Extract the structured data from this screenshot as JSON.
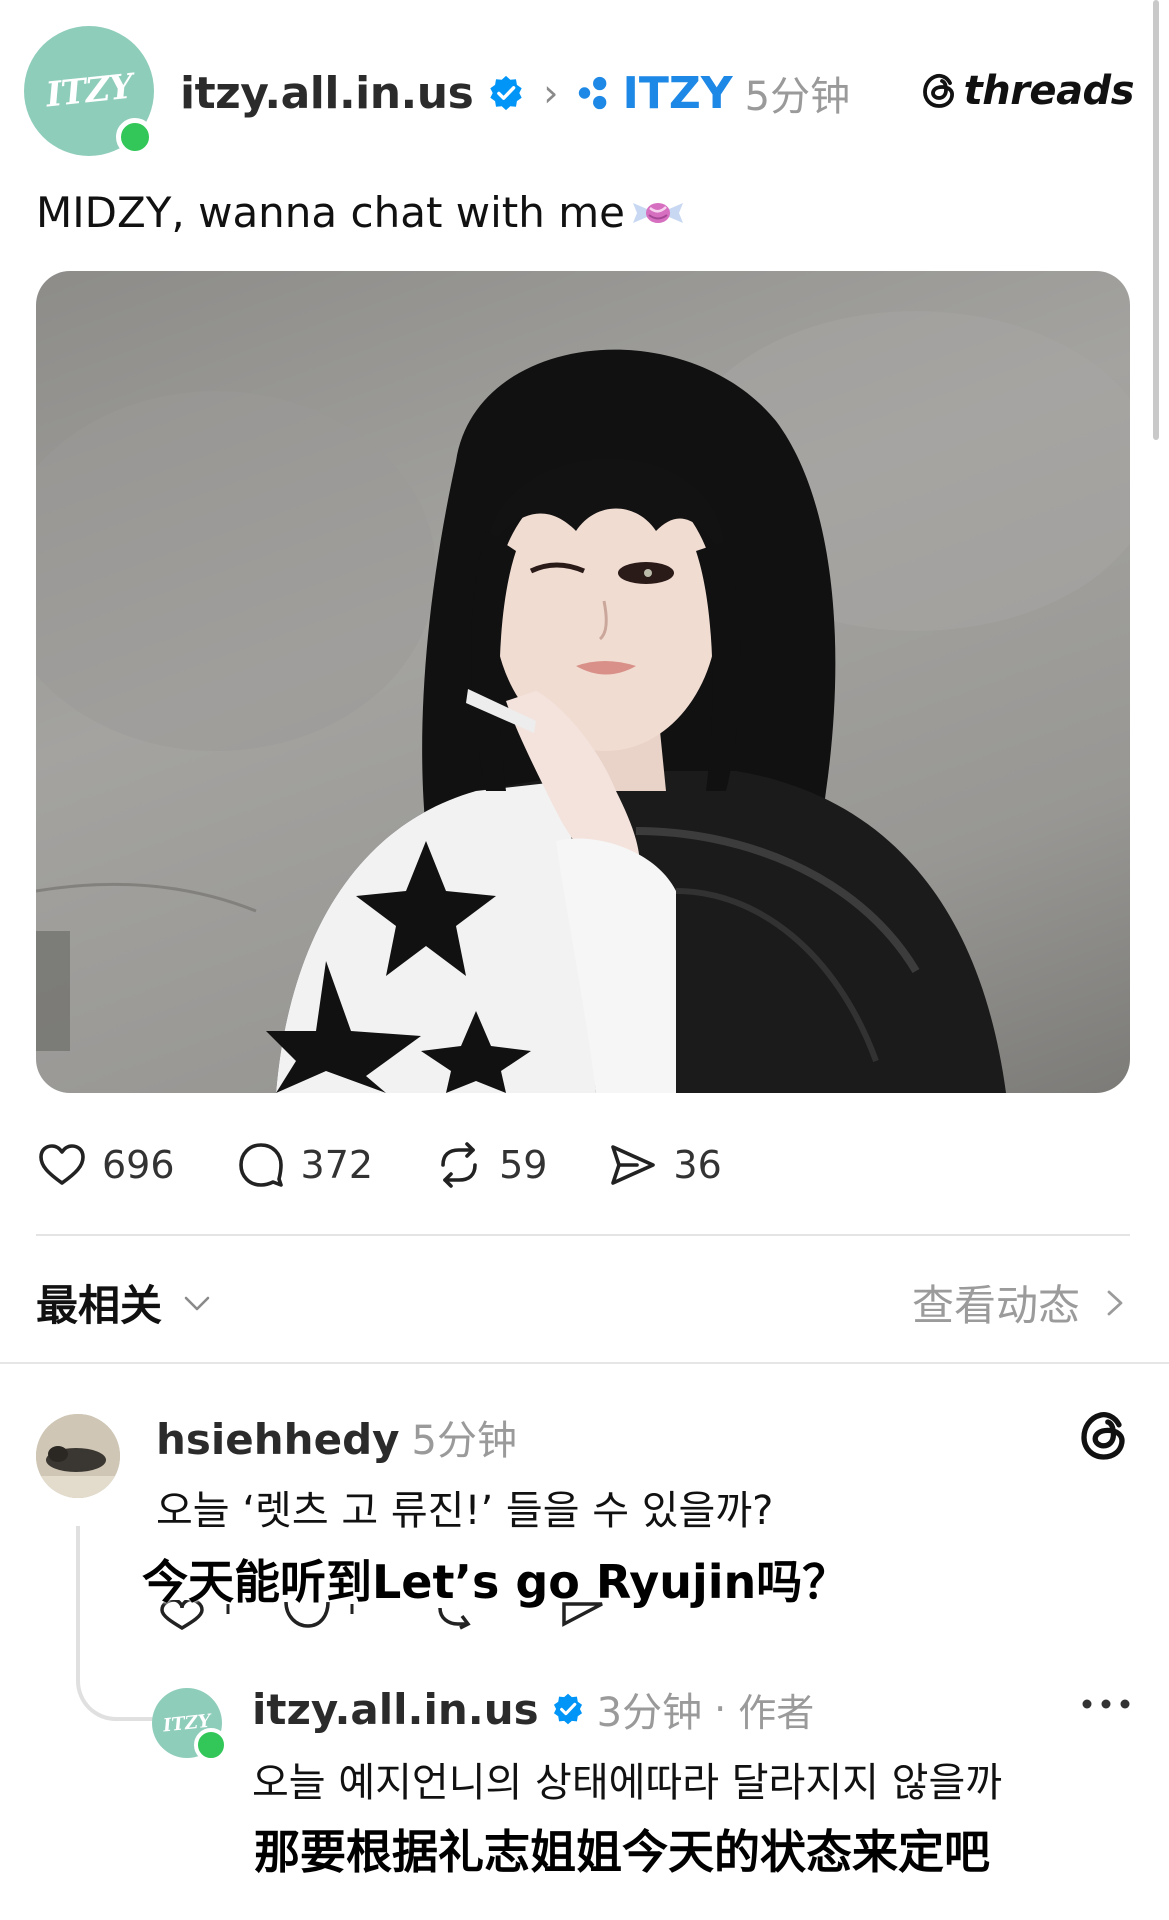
{
  "post": {
    "author": "itzy.all.in.us",
    "avatar_logo": "ITZY",
    "community": "ITZY",
    "time": "5分钟",
    "brand": "threads",
    "caption": "MIDZY, wanna chat with me",
    "photo_alt": "photo",
    "stats": {
      "likes": "696",
      "comments": "372",
      "reposts": "59",
      "shares": "36"
    }
  },
  "sort": {
    "label": "最相关",
    "activity_link": "查看动态"
  },
  "comments": [
    {
      "user": "hsiehhedy",
      "time": "5分钟",
      "text": "오늘 ‘렛츠 고 류진!’ 들을 수 있을까?",
      "subtitle": "今天能听到Let’s go Ryujin吗？"
    },
    {
      "user": "itzy.all.in.us",
      "avatar_logo": "ITZY",
      "time": "3分钟",
      "separator": "·",
      "author_tag": "作者",
      "text": "오늘 예지언니의 상태에따라 달라지지 않을까",
      "subtitle": "那要根据礼志姐姐今天的状态来定吧"
    }
  ],
  "colors": {
    "accent_blue": "#1d88e6",
    "verified_blue": "#0095f6",
    "online_green": "#33c759",
    "avatar_mint": "#8fcdbb"
  },
  "icons": {
    "verified": "verified-badge-icon",
    "community": "community-icon",
    "like": "heart-icon",
    "comment": "comment-bubble-icon",
    "repost": "repost-icon",
    "share": "send-icon",
    "threads": "threads-logo-icon",
    "more": "more-dots-icon"
  }
}
